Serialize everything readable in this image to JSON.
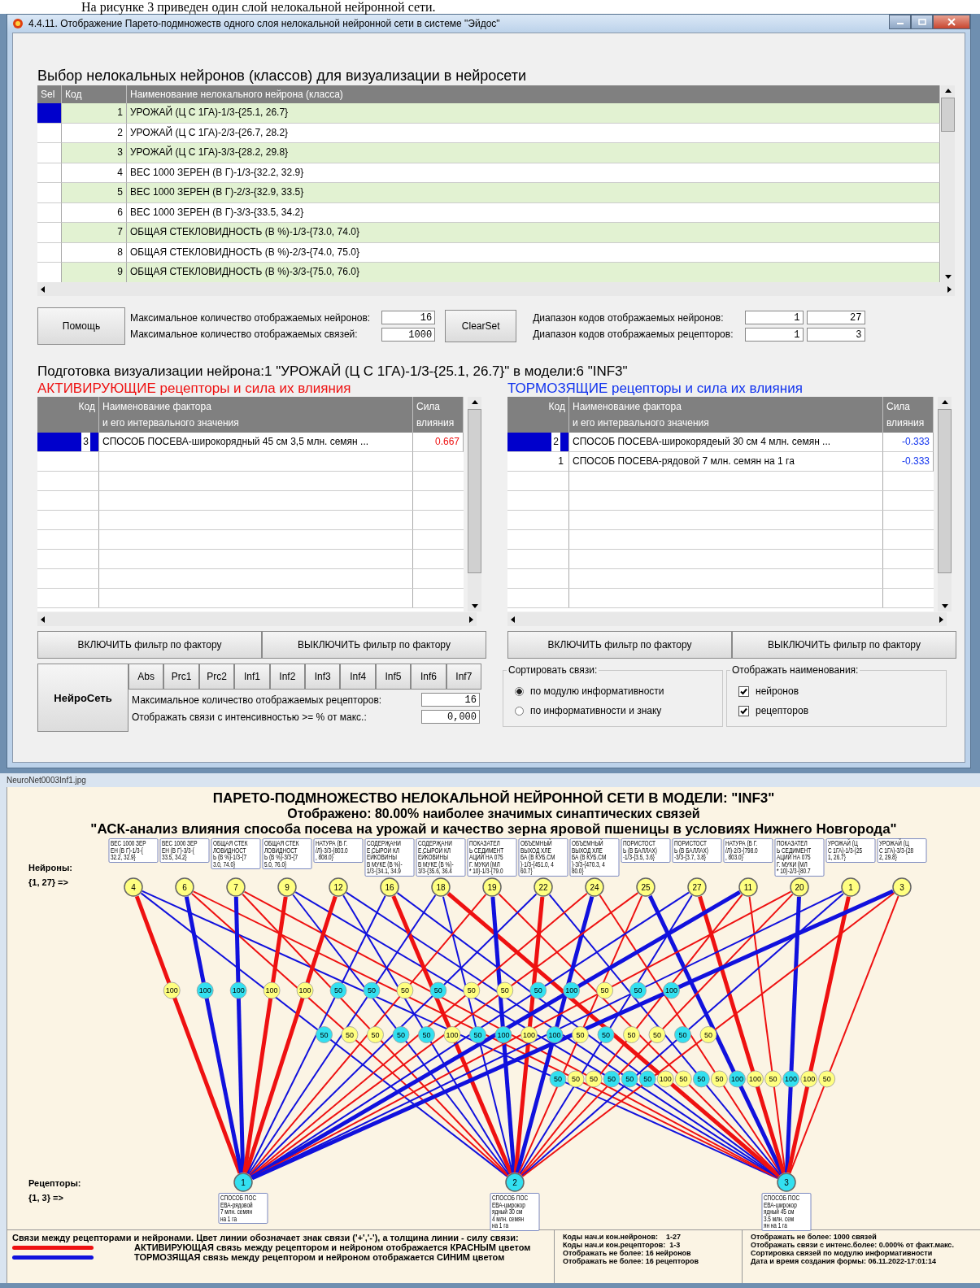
{
  "caption_text": "На рисунке 3 приведен один слой нелокальной нейронной сети.",
  "window": {
    "title": "4.4.11. Отображение Парето-подмножеств одного слоя нелокальной нейронной сети в системе \"Эйдос\""
  },
  "neuron_select": {
    "heading": "Выбор нелокальных нейронов (классов) для визуализации в нейросети",
    "columns": [
      "Sel",
      "Код",
      "Наименование нелокального нейрона (класса)"
    ],
    "rows": [
      {
        "code": "1",
        "name": "УРОЖАЙ (Ц С 1ГА)-1/3-{25.1, 26.7}",
        "selected": true
      },
      {
        "code": "2",
        "name": "УРОЖАЙ (Ц С 1ГА)-2/3-{26.7, 28.2}",
        "selected": false
      },
      {
        "code": "3",
        "name": "УРОЖАЙ (Ц С 1ГА)-3/3-{28.2, 29.8}",
        "selected": false
      },
      {
        "code": "4",
        "name": "ВЕС 1000 ЗЕРЕН (В Г)-1/3-{32.2, 32.9}",
        "selected": false
      },
      {
        "code": "5",
        "name": "ВЕС 1000 ЗЕРЕН (В Г)-2/3-{32.9, 33.5}",
        "selected": false
      },
      {
        "code": "6",
        "name": "ВЕС 1000 ЗЕРЕН (В Г)-3/3-{33.5, 34.2}",
        "selected": false
      },
      {
        "code": "7",
        "name": "ОБЩАЯ СТЕКЛОВИДНОСТЬ (В %)-1/3-{73.0, 74.0}",
        "selected": false
      },
      {
        "code": "8",
        "name": "ОБЩАЯ СТЕКЛОВИДНОСТЬ (В %)-2/3-{74.0, 75.0}",
        "selected": false
      },
      {
        "code": "9",
        "name": "ОБЩАЯ СТЕКЛОВИДНОСТЬ (В %)-3/3-{75.0, 76.0}",
        "selected": false
      }
    ]
  },
  "settings": {
    "help_button": "Помощь",
    "max_neurons_label": "Максимальное количество отображаемых нейронов:",
    "max_neurons": "16",
    "max_links_label": "Максимальное количество отображаемых связей:",
    "max_links": "1000",
    "clearset_button": "ClearSet",
    "neuron_range_label": "Диапазон кодов отображаемых нейронов:",
    "neuron_range": [
      "1",
      "27"
    ],
    "receptor_range_label": "Диапазон кодов отображаемых рецепторов:",
    "receptor_range": [
      "1",
      "3"
    ]
  },
  "prep_heading": "Подготовка визуализации нейрона:1 \"УРОЖАЙ (Ц С 1ГА)-1/3-{25.1, 26.7}\" в модели:6 \"INF3\"",
  "panels": [
    {
      "kind": "activating",
      "heading": "АКТИВИРУЮЩИЕ рецепторы и сила их влияния",
      "columns": [
        "Код",
        "Наименование фактора\nи его интервального значения",
        "Сила\nвлияния"
      ],
      "rows": [
        {
          "code": "3",
          "name": "СПОСОБ ПОСЕВА-широкорядный 45 см  3,5 млн.  семян  ...",
          "value": "0.667",
          "selected": true
        }
      ],
      "buttons": [
        "ВКЛЮЧИТЬ фильтр по фактору",
        "ВЫКЛЮЧИТЬ фильтр по фактору"
      ]
    },
    {
      "kind": "inhibiting",
      "heading": "ТОРМОЗЯЩИЕ   рецепторы и сила их влияния",
      "columns": [
        "Код",
        "Наименование фактора\nи его интервального значения",
        "Сила\nвлияния"
      ],
      "rows": [
        {
          "code": "2",
          "name": "СПОСОБ ПОСЕВА-широкорядеый 30 см  4 млн.  семян  ...",
          "value": "-0.333",
          "selected": true
        },
        {
          "code": "1",
          "name": "СПОСОБ ПОСЕВА-рядовой 7 млн.  семян  на 1 га",
          "value": "-0.333",
          "selected": false
        }
      ],
      "buttons": [
        "ВКЛЮЧИТЬ фильтр по фактору",
        "ВЫКЛЮЧИТЬ фильтр по фактору"
      ]
    }
  ],
  "network_controls": {
    "main_button": "НейроСеть",
    "modes": [
      "Abs",
      "Prc1",
      "Prc2",
      "Inf1",
      "Inf2",
      "Inf3",
      "Inf4",
      "Inf5",
      "Inf6",
      "Inf7"
    ],
    "max_receptors_label": "Максимальное количество отображаемых рецепторов:",
    "max_receptors": "16",
    "threshold_label": "Отображать связи с интенсивностью >= % от макс.:",
    "threshold": "0,000"
  },
  "sort_group": {
    "title": "Сортировать связи:",
    "options": [
      {
        "label": "по модулю информативности",
        "selected": true
      },
      {
        "label": "по информативности и знаку",
        "selected": false
      }
    ]
  },
  "names_group": {
    "title": "Отображать наименования:",
    "options": [
      {
        "label": "нейронов",
        "checked": true
      },
      {
        "label": "рецепторов",
        "checked": true
      }
    ]
  },
  "viewer": {
    "title": "NeuroNet0003Inf1.jpg",
    "titles": [
      "ПАРЕТО-ПОДМНОЖЕСТВО НЕЛОКАЛЬНОЙ НЕЙРОННОЙ СЕТИ В МОДЕЛИ: \"INF3\"",
      "Отображено: 80.00% наиболее значимых синаптических связей",
      "\"АСК-анализ влияния способа посева на урожай и качество зерна яровой пшеницы в условиях Нижнего Новгорода\""
    ],
    "neurons_label": "Нейроны:",
    "neurons_range": "{1, 27} =>",
    "receptors_label": "Рецепторы:",
    "receptors_range": "{1, 3} =>",
    "neurons": [
      {
        "number": "4",
        "lines": [
          "ВЕС 1000 ЗЕР",
          "ЕН (В Г)-1/3-{",
          "32.2, 32.9}"
        ],
        "links": [
          {
            "kind": "activating-strong",
            "label": "100"
          },
          {
            "kind": "inhibiting-weak",
            "label": "50"
          },
          {
            "kind": "inhibiting-weak",
            "label": "50"
          }
        ]
      },
      {
        "number": "6",
        "lines": [
          "ВЕС 1000 ЗЕР",
          "ЕН (В Г)-3/3-{",
          "33.5, 34.2}"
        ],
        "links": [
          {
            "kind": "inhibiting-strong",
            "label": "100"
          },
          {
            "kind": "activating-weak",
            "label": "50"
          },
          {
            "kind": "activating-weak",
            "label": "50"
          }
        ]
      },
      {
        "number": "7",
        "lines": [
          "ОБЩАЯ СТЕК",
          "ЛОВИДНОСТ",
          "Ь (В %)-1/3-{7",
          "3.0, 74.0}"
        ],
        "links": [
          {
            "kind": "inhibiting-strong",
            "label": "100"
          },
          {
            "kind": "activating-weak",
            "label": "50"
          },
          {
            "kind": "activating-weak",
            "label": "50"
          }
        ]
      },
      {
        "number": "9",
        "lines": [
          "ОБЩАЯ СТЕК",
          "ЛОВИДНОСТ",
          "Ь (В %)-3/3-{7",
          "5.0, 76.0}"
        ],
        "links": [
          {
            "kind": "activating-strong",
            "label": "100"
          },
          {
            "kind": "inhibiting-weak",
            "label": "50"
          },
          {
            "kind": "inhibiting-weak",
            "label": "50"
          }
        ]
      },
      {
        "number": "12",
        "lines": [
          "НАТУРА (В Г.",
          "/Л)-3/3-{803.0",
          ", 808.0}"
        ],
        "links": [
          {
            "kind": "activating-strong",
            "label": "100"
          },
          {
            "kind": "inhibiting-weak",
            "label": "50"
          },
          {
            "kind": "inhibiting-weak",
            "label": "50"
          }
        ]
      },
      {
        "number": "16",
        "lines": [
          "СОДЕРЖАНИ",
          "Е СЫРОЙ КЛ",
          "ЕЙКОВИНЫ",
          "В МУКЕ (В %)-",
          "1/3-{34.1, 34.9"
        ],
        "links": [
          {
            "kind": "inhibiting-weak",
            "label": "50"
          },
          {
            "kind": "activating-strong",
            "label": "100"
          },
          {
            "kind": "inhibiting-weak",
            "label": "50"
          }
        ]
      },
      {
        "number": "18",
        "lines": [
          "СОДЕРЖАНИ",
          "Е СЫРОЙ КЛ",
          "ЕЙКОВИНЫ",
          "В МУКЕ (В %)-",
          "3/3-{35.6, 36.4"
        ],
        "links": [
          {
            "kind": "inhibiting-weak",
            "label": "50"
          },
          {
            "kind": "inhibiting-weak",
            "label": "50"
          },
          {
            "kind": "activating-strong",
            "label": "100"
          }
        ]
      },
      {
        "number": "19",
        "lines": [
          "ПОКАЗАТЕЛ",
          "Ь СЕДИМЕНТ",
          "АЦИИ НА 075",
          "Г. МУКИ (МЛ",
          "* 10)-1/3-{79.0"
        ],
        "links": [
          {
            "kind": "activating-weak",
            "label": "50"
          },
          {
            "kind": "inhibiting-strong",
            "label": "100"
          },
          {
            "kind": "activating-weak",
            "label": "50"
          }
        ]
      },
      {
        "number": "22",
        "lines": [
          "ОБЪЕМНЫЙ",
          "ВЫХОД ХЛЕ",
          "БА (В КУБ.СМ",
          ")-1/3-{451.0, 4",
          "60.7}"
        ],
        "links": [
          {
            "kind": "inhibiting-weak",
            "label": "50"
          },
          {
            "kind": "activating-strong",
            "label": "100"
          },
          {
            "kind": "inhibiting-weak",
            "label": "50"
          }
        ]
      },
      {
        "number": "24",
        "lines": [
          "ОБЪЕМНЫЙ",
          "ВЫХОД ХЛЕ",
          "БА (В КУБ.СМ",
          ")-3/3-{470.3, 4",
          "80.0}"
        ],
        "links": [
          {
            "kind": "activating-weak",
            "label": "50"
          },
          {
            "kind": "inhibiting-strong",
            "label": "100"
          },
          {
            "kind": "activating-weak",
            "label": "50"
          }
        ]
      },
      {
        "number": "25",
        "lines": [
          "ПОРИСТОСТ",
          "Ь (В БАЛЛАХ)",
          "-1/3-{3.5, 3.6}"
        ],
        "links": [
          {
            "kind": "activating-weak",
            "label": "50"
          },
          {
            "kind": "activating-weak",
            "label": "50"
          },
          {
            "kind": "inhibiting-strong",
            "label": "100"
          }
        ]
      },
      {
        "number": "27",
        "lines": [
          "ПОРИСТОСТ",
          "Ь (В БАЛЛАХ)",
          "-3/3-{3.7, 3.8}"
        ],
        "links": [
          {
            "kind": "inhibiting-weak",
            "label": "50"
          },
          {
            "kind": "inhibiting-weak",
            "label": "50"
          },
          {
            "kind": "activating-strong",
            "label": "100"
          }
        ]
      },
      {
        "number": "11",
        "lines": [
          "НАТУРА (В Г.",
          "/Л)-2/3-{798.0",
          ", 803.0}"
        ],
        "links": [
          {
            "kind": "inhibiting-strong",
            "label": "100"
          },
          {
            "kind": "activating-weak",
            "label": "50"
          },
          {
            "kind": "activating-weak",
            "label": "50"
          }
        ]
      },
      {
        "number": "20",
        "lines": [
          "ПОКАЗАТЕЛ",
          "Ь СЕДИМЕНТ",
          "АЦИИ НА 075",
          "Г. МУКИ (МЛ",
          "* 10)-2/3-{80.7"
        ],
        "links": [
          {
            "kind": "activating-weak",
            "label": "50"
          },
          {
            "kind": "activating-weak",
            "label": "50"
          },
          {
            "kind": "inhibiting-strong",
            "label": "100"
          }
        ]
      },
      {
        "number": "1",
        "lines": [
          "УРОЖАЙ (Ц",
          "С 1ГА)-1/3-{25",
          "1, 26.7}"
        ],
        "links": [
          {
            "kind": "inhibiting-weak",
            "label": "50"
          },
          {
            "kind": "inhibiting-weak",
            "label": "50"
          },
          {
            "kind": "activating-strong",
            "label": "100"
          }
        ]
      },
      {
        "number": "3",
        "lines": [
          "УРОЖАЙ (Ц",
          "С 1ГА)-3/3-{28",
          "2, 29.8}"
        ],
        "links": [
          {
            "kind": "inhibiting-strong",
            "label": "100"
          },
          {
            "kind": "activating-weak",
            "label": "50"
          },
          {
            "kind": "activating-weak",
            "label": "50"
          }
        ]
      }
    ],
    "receptors": [
      {
        "number": "1",
        "lines": [
          "СПОСОБ ПОС",
          "ЕВА-рядовой",
          "7 млн. семян",
          "на 1 га"
        ]
      },
      {
        "number": "2",
        "lines": [
          "СПОСОБ ПОС",
          "ЕВА-широкор",
          "ядный 30 см",
          "4 млн. семян",
          "на 1 га"
        ]
      },
      {
        "number": "3",
        "lines": [
          "СПОСОБ ПОС",
          "ЕВА-широкор",
          "ядный 45 см",
          "3.5 млн. сем",
          "ян на 1 га"
        ]
      }
    ],
    "legend": {
      "intro": "Связи между рецепторами и нейронами. Цвет линии обозначает знак связи ('+','-'), а толщина линии - силу связи:",
      "items": [
        {
          "kind": "activating",
          "text": "АКТИВИРУЮЩАЯ связь между рецептором и нейроном отображается КРАСНЫМ цветом"
        },
        {
          "kind": "inhibiting",
          "text": "ТОРМОЗЯЩАЯ связь между рецептором и нейроном отображается СИНИМ цветом"
        }
      ],
      "middle": [
        "Коды нач.и кон.нейронов:    1-27",
        "Коды нач.и кон.рецепторов:  1-3",
        "Отображать не более: 16 нейронов",
        "Отображать не более: 16 рецепторов"
      ],
      "right": [
        "Отображать не более: 1000 связей",
        "Отображать связи с интенс.более: 0.000% от факт.макс.",
        "Сортировка связей по модулю информативности",
        "Дата и время создания формы: 06.11.2022-17:01:14"
      ]
    }
  }
}
